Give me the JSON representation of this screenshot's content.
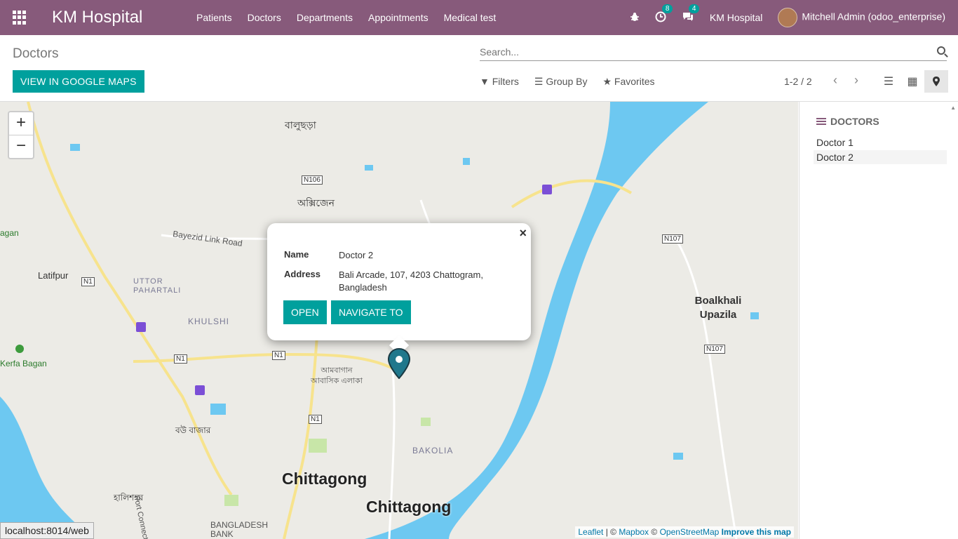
{
  "navbar": {
    "brand": "KM Hospital",
    "menu": [
      "Patients",
      "Doctors",
      "Departments",
      "Appointments",
      "Medical test"
    ],
    "activity_badge": "8",
    "messages_badge": "4",
    "company": "KM Hospital",
    "user": "Mitchell Admin (odoo_enterprise)"
  },
  "control_panel": {
    "breadcrumb": "Doctors",
    "gmaps_button": "VIEW IN GOOGLE MAPS",
    "search_placeholder": "Search...",
    "filters": "Filters",
    "group_by": "Group By",
    "favorites": "Favorites",
    "pager": "1-2 / 2"
  },
  "map": {
    "labels": [
      "বালুছড়া",
      "N106",
      "অক্সিজেন",
      "Bayezid Link Road",
      "agan",
      "Latifpur",
      "N1",
      "UTTOR PAHARTALI",
      "KHULSHI",
      "N107",
      "Boalkhali Upazila",
      "N107",
      "Kerfa Bagan",
      "N1",
      "N1",
      "আমবাগান আবাসিক এলাকা",
      "N1",
      "বউ বাজার",
      "Port Connecting Rd",
      "BAKOLIA",
      "Chittagong",
      "Chittagong",
      "হালিশহর",
      "BANGLADESH BANK"
    ],
    "popup": {
      "name_label": "Name",
      "name_value": "Doctor 2",
      "address_label": "Address",
      "address_value": "Bali Arcade, 107, 4203 Chattogram, Bangladesh",
      "open_button": "OPEN",
      "navigate_button": "NAVIGATE TO",
      "close": "×"
    },
    "attribution": {
      "leaflet": "Leaflet",
      "sep1": " | © ",
      "mapbox": "Mapbox",
      "sep2": " © ",
      "osm": "OpenStreetMap",
      "improve": "Improve this map"
    }
  },
  "status_url": "localhost:8014/web",
  "sidebar": {
    "title": "DOCTORS",
    "items": [
      "Doctor 1",
      "Doctor 2"
    ]
  }
}
